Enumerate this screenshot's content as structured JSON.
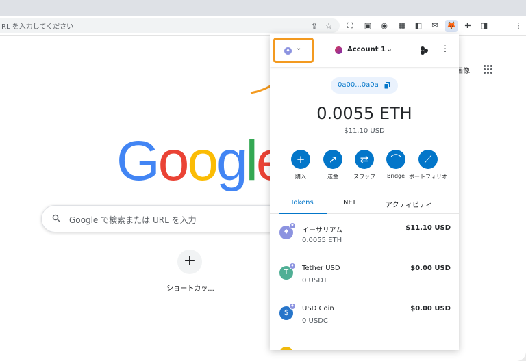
{
  "browser": {
    "address_placeholder": "RL を入力してください",
    "share_icon": "share-icon",
    "bookmark_icon": "star-icon"
  },
  "google_page": {
    "logo_letters": [
      {
        "ch": "G",
        "color": "#4285f4"
      },
      {
        "ch": "o",
        "color": "#ea4335"
      },
      {
        "ch": "o",
        "color": "#fbbc05"
      },
      {
        "ch": "g",
        "color": "#4285f4"
      },
      {
        "ch": "l",
        "color": "#34a853"
      },
      {
        "ch": "e",
        "color": "#ea4335"
      }
    ],
    "search_placeholder": "Google で検索または URL を入力",
    "images_link": "画像",
    "shortcut_add": "+",
    "shortcut_label": "ショートカッ..."
  },
  "metamask": {
    "account_name": "Account 1",
    "address_short": "0a00...0a0a",
    "balance_main": "0.0055 ETH",
    "balance_fiat": "$11.10 USD",
    "actions": [
      {
        "label": "購入",
        "icon": "plus-icon",
        "glyph": "+"
      },
      {
        "label": "送金",
        "icon": "arrow-up-right-icon",
        "glyph": "↗"
      },
      {
        "label": "スワップ",
        "icon": "swap-icon",
        "glyph": "⇄"
      },
      {
        "label": "Bridge",
        "icon": "bridge-icon",
        "glyph": "⌒"
      },
      {
        "label": "ポートフォリオ",
        "icon": "chart-icon",
        "glyph": "⟋"
      }
    ],
    "tabs": [
      "Tokens",
      "NFT",
      "アクティビティ"
    ],
    "tokens": [
      {
        "name": "イーサリアム",
        "amount": "0.0055 ETH",
        "fiat": "$11.10 USD",
        "icon_color": "#8c93e0",
        "glyph": "♦"
      },
      {
        "name": "Tether USD",
        "amount": "0 USDT",
        "fiat": "$0.00 USD",
        "icon_color": "#50af95",
        "glyph": "T"
      },
      {
        "name": "USD Coin",
        "amount": "0 USDC",
        "fiat": "$0.00 USD",
        "icon_color": "#2775ca",
        "glyph": "$"
      }
    ],
    "accent_color": "#0376c9",
    "highlight_color": "#f39a20"
  }
}
